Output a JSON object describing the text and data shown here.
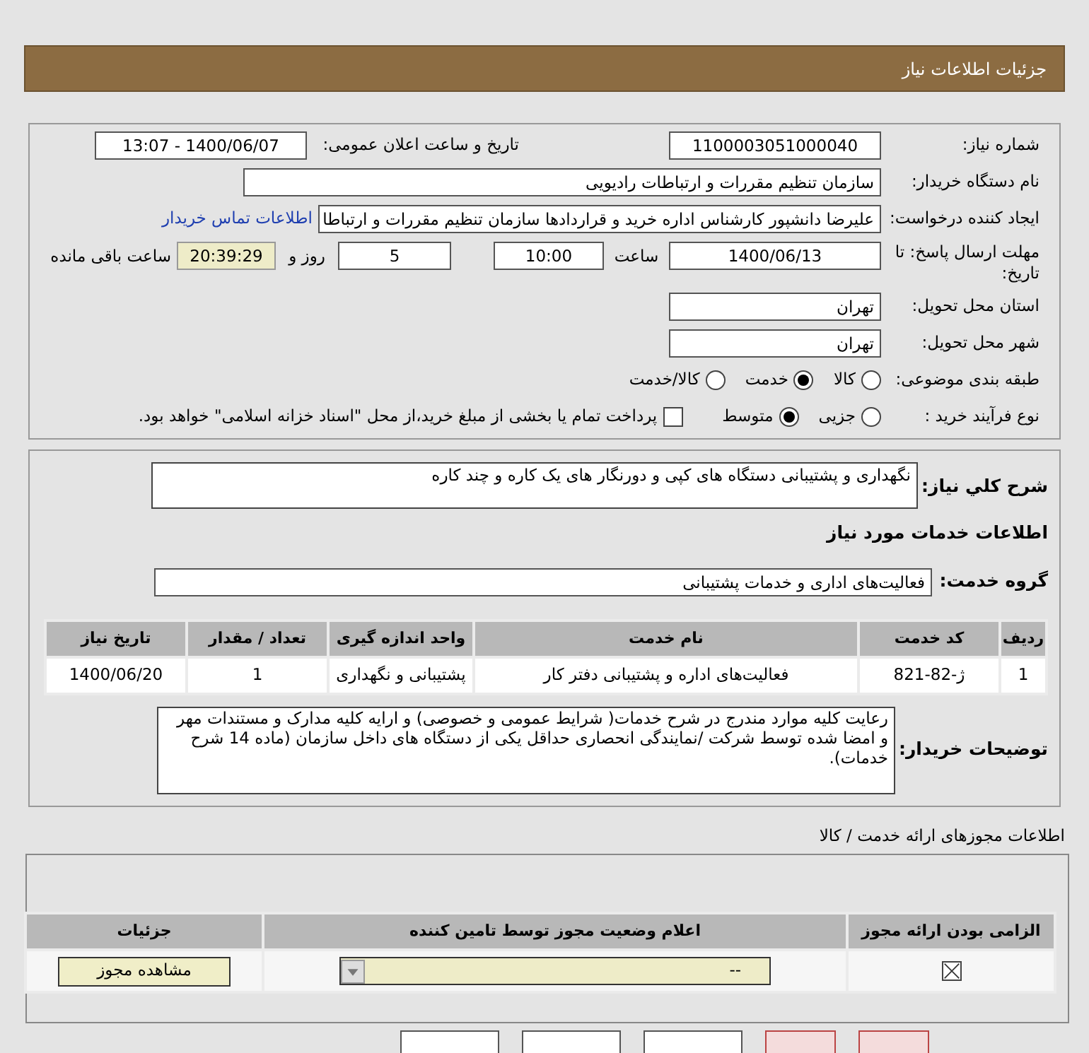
{
  "header": {
    "title": "جزئیات اطلاعات نیاز"
  },
  "need_number": {
    "label": "شماره نیاز:",
    "value": "1100003051000040"
  },
  "announce": {
    "label": "تاریخ و ساعت اعلان عمومی:",
    "value": "1400/06/07 - 13:07"
  },
  "buyer": {
    "label": "نام دستگاه خریدار:",
    "value": "سازمان تنظیم مقررات و ارتباطات رادیویی"
  },
  "requester": {
    "label": "ایجاد کننده درخواست:",
    "value": "علیرضا دانشپور کارشناس اداره خرید و قراردادها سازمان تنظیم مقررات و ارتباطا",
    "link": "اطلاعات تماس خریدار"
  },
  "deadline": {
    "label": "مهلت ارسال پاسخ: تا تاریخ:",
    "date": "1400/06/13",
    "time_label": "ساعت",
    "time": "10:00",
    "days": "5",
    "days_label": "روز و",
    "remaining": "20:39:29",
    "remaining_label": "ساعت باقی مانده"
  },
  "province": {
    "label": "استان محل تحویل:",
    "value": "تهران"
  },
  "city": {
    "label": "شهر محل تحویل:",
    "value": "تهران"
  },
  "category": {
    "label": "طبقه بندی موضوعی:",
    "options": [
      {
        "label": "کالا",
        "selected": false
      },
      {
        "label": "خدمت",
        "selected": true
      },
      {
        "label": "کالا/خدمت",
        "selected": false
      }
    ]
  },
  "process": {
    "label": "نوع فرآیند خرید :",
    "options": [
      {
        "label": "جزیی",
        "selected": false
      },
      {
        "label": "متوسط",
        "selected": true
      }
    ],
    "checkbox": {
      "label": "پرداخت تمام یا بخشی از مبلغ خرید،از محل \"اسناد خزانه اسلامی\" خواهد بود.",
      "checked": false
    }
  },
  "description": {
    "label": "شرح کلي نياز:",
    "value": "نگهداری و پشتیبانی دستگاه های کپی و دورنگار های یک کاره و چند کاره"
  },
  "services_title": "اطلاعات خدمات مورد نیاز",
  "service_group": {
    "label": "گروه خدمت:",
    "value": "فعالیت‌های اداری و خدمات پشتیبانی"
  },
  "services_table": {
    "columns": [
      "ردیف",
      "کد خدمت",
      "نام خدمت",
      "واحد اندازه گیری",
      "تعداد / مقدار",
      "تاریخ نیاز"
    ],
    "rows": [
      [
        "1",
        "ژ-82-821",
        "فعالیت‌های اداره و پشتیبانی دفتر کار",
        "پشتیبانی و نگهداری",
        "1",
        "1400/06/20"
      ]
    ]
  },
  "buyer_notes": {
    "label": "توضیحات خریدار:",
    "value": "رعایت کلیه موارد مندرج در شرح خدمات( شرایط عمومی و خصوصی) و ارایه کلیه مدارک و مستندات مهر و امضا شده توسط شرکت /نمایندگی انحصاری حداقل یکی از دستگاه های داخل سازمان (ماده 14 شرح خدمات)."
  },
  "permits": {
    "title": "اطلاعات مجوزهای ارائه خدمت / کالا",
    "columns": [
      "الزامی بودن ارائه مجوز",
      "اعلام وضعیت مجوز توسط تامین کننده",
      "جزئیات"
    ],
    "rows": [
      {
        "required": true,
        "status": "--",
        "button": "مشاهده مجوز"
      }
    ]
  },
  "bottom_buttons": [
    {
      "kind": "danger"
    },
    {
      "kind": "danger"
    },
    {
      "kind": "plain"
    },
    {
      "kind": "plain"
    },
    {
      "kind": "plain"
    }
  ]
}
